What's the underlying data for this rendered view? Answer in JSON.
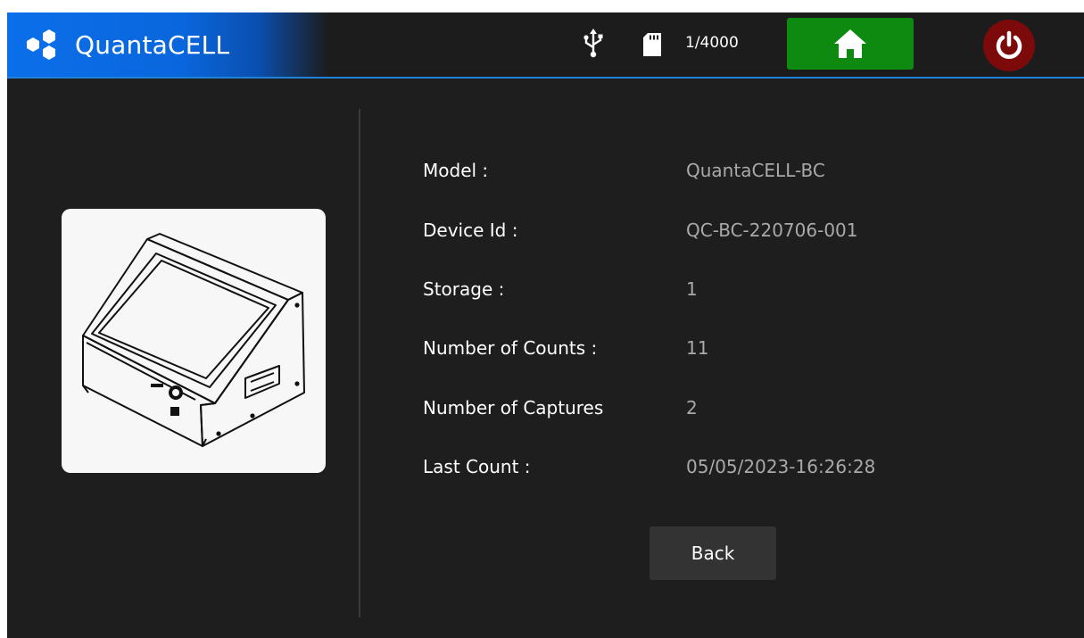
{
  "header": {
    "app_name": "QuantaCELL",
    "storage_count": "1/4000",
    "icons": {
      "logo": "hexagon-cluster-logo",
      "usb": "usb-icon",
      "sd": "sd-card-icon",
      "home": "home-icon",
      "power": "power-icon"
    },
    "colors": {
      "brand_blue": "#0b6fea",
      "home_green": "#0e8a10",
      "power_red": "#7c0a0a",
      "accent_line": "#1f82d6"
    }
  },
  "device": {
    "image": "device-illustration"
  },
  "info": {
    "model_label": "Model :",
    "model_value": "QuantaCELL-BC",
    "device_id_label": "Device Id :",
    "device_id_value": "QC-BC-220706-001",
    "storage_label": "Storage :",
    "storage_value": "1",
    "counts_label": "Number of Counts :",
    "counts_value": "11",
    "captures_label": "Number of Captures",
    "captures_value": "2",
    "last_count_label": "Last Count :",
    "last_count_value": "05/05/2023-16:26:28"
  },
  "actions": {
    "back_label": "Back"
  }
}
